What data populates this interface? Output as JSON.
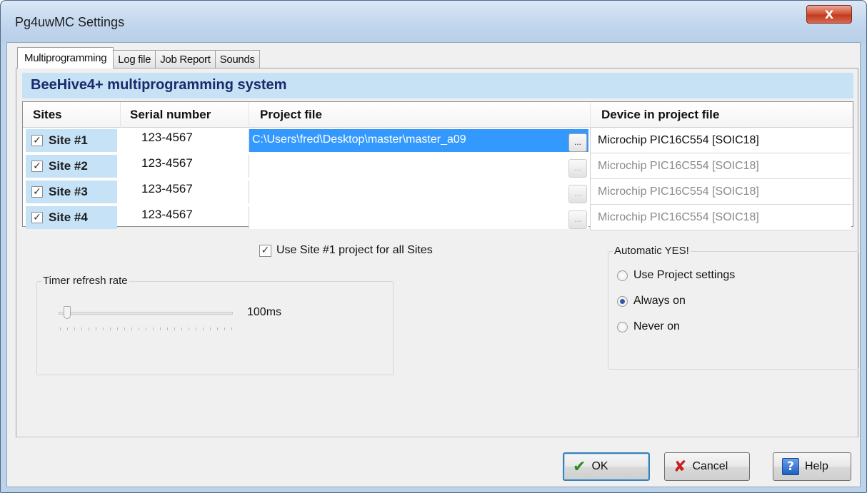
{
  "window": {
    "title": "Pg4uwMC Settings",
    "close_glyph": "X"
  },
  "tabs": [
    {
      "label": "Multiprogramming",
      "active": true
    },
    {
      "label": "Log file",
      "active": false
    },
    {
      "label": "Job Report",
      "active": false
    },
    {
      "label": "Sounds",
      "active": false
    }
  ],
  "panel": {
    "header": "BeeHive4+ multiprogramming system",
    "columns": {
      "sites": "Sites",
      "serial": "Serial number",
      "project": "Project file",
      "device": "Device in project file"
    },
    "rows": [
      {
        "checked": true,
        "check_glyph": "✓",
        "site": "Site #1",
        "serial": "123-4567",
        "project": "C:\\Users\\fred\\Desktop\\master\\master_a09",
        "browse": "...",
        "device": "Microchip PIC16C554 [SOIC18]",
        "enabled": true
      },
      {
        "checked": true,
        "check_glyph": "✓",
        "site": "Site #2",
        "serial": "123-4567",
        "project": "",
        "browse": "...",
        "device": "Microchip PIC16C554 [SOIC18]",
        "enabled": false
      },
      {
        "checked": true,
        "check_glyph": "✓",
        "site": "Site #3",
        "serial": "123-4567",
        "project": "",
        "browse": "...",
        "device": "Microchip PIC16C554 [SOIC18]",
        "enabled": false
      },
      {
        "checked": true,
        "check_glyph": "✓",
        "site": "Site #4",
        "serial": "123-4567",
        "project": "",
        "browse": "...",
        "device": "Microchip PIC16C554 [SOIC18]",
        "enabled": false
      }
    ],
    "use_site1": {
      "label": "Use Site #1 project for all Sites",
      "checked": true,
      "check_glyph": "✓"
    },
    "timer": {
      "title": "Timer refresh rate",
      "value_label": "100ms",
      "level": 0.03
    },
    "automatic_yes": {
      "title": "Automatic YES!",
      "options": [
        {
          "label": "Use Project settings",
          "selected": false
        },
        {
          "label": "Always on",
          "selected": true
        },
        {
          "label": "Never on",
          "selected": false
        }
      ]
    }
  },
  "buttons": {
    "ok": {
      "label": "OK",
      "icon": "checkmark-icon",
      "glyph": "✔"
    },
    "cancel": {
      "label": "Cancel",
      "icon": "x-icon",
      "glyph": "✘"
    },
    "help": {
      "label": "Help",
      "icon": "help-icon",
      "glyph": "?"
    }
  }
}
